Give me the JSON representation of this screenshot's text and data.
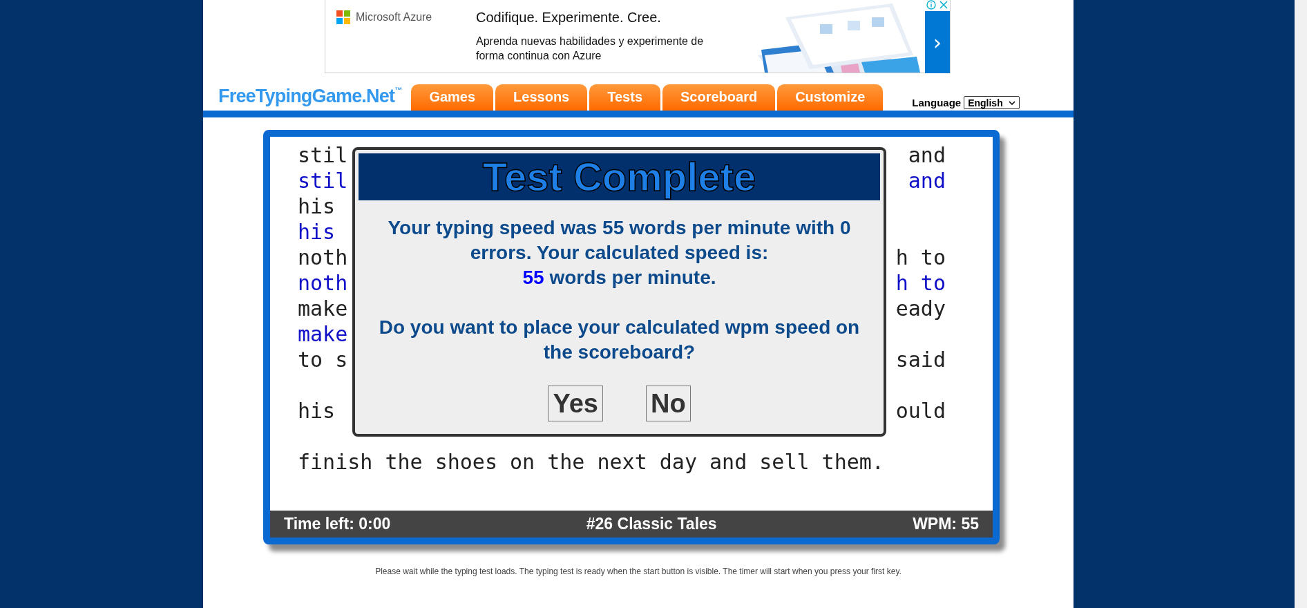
{
  "ad": {
    "brand": "Microsoft Azure",
    "headline": "Codifique. Experimente. Cree.",
    "body": "Aprenda nuevas habilidades y experimente de forma continua con Azure",
    "next": "›"
  },
  "header": {
    "logo": "FreeTypingGame.Net",
    "logo_mark": "™",
    "tabs": [
      {
        "label": "Games"
      },
      {
        "label": "Lessons"
      },
      {
        "label": "Tests"
      },
      {
        "label": "Scoreboard"
      },
      {
        "label": "Customize"
      }
    ],
    "language": {
      "label": "Language",
      "value": "English"
    }
  },
  "test": {
    "paragraphs": [
      [
        {
          "kind": "source",
          "left": "stil",
          "right": "and"
        },
        {
          "kind": "typed",
          "left": "stil",
          "right": "and"
        },
        {
          "kind": "source",
          "left": "his"
        },
        {
          "kind": "typed",
          "left": "his"
        },
        {
          "kind": "source",
          "left": "noth",
          "right": "h to"
        },
        {
          "kind": "typed",
          "left": "noth",
          "right": "h to"
        },
        {
          "kind": "source",
          "left": "make",
          "right": "eady"
        },
        {
          "kind": "typed",
          "left": "make"
        },
        {
          "kind": "source",
          "left": "to s",
          "right": "said"
        }
      ],
      [
        {
          "kind": "source",
          "left": "his",
          "right": "ould"
        }
      ],
      [
        {
          "kind": "source",
          "left": "finish the shoes on the next day and sell them."
        }
      ]
    ],
    "status": {
      "time": "Time left: 0:00",
      "title": "#26 Classic Tales",
      "wpm": "WPM: 55"
    }
  },
  "dialog": {
    "title": "Test Complete",
    "message": "Your typing speed was 55 words per minute with 0 errors. Your calculated speed is:",
    "speed": "55",
    "speed_unit": "words per minute.",
    "question": "Do you want to place your calculated wpm speed on the scoreboard?",
    "buttons": [
      "Yes",
      "No"
    ]
  },
  "footer": "Please wait while the typing test loads. The typing test is ready when the start button is visible. The timer will start when you press your first key."
}
